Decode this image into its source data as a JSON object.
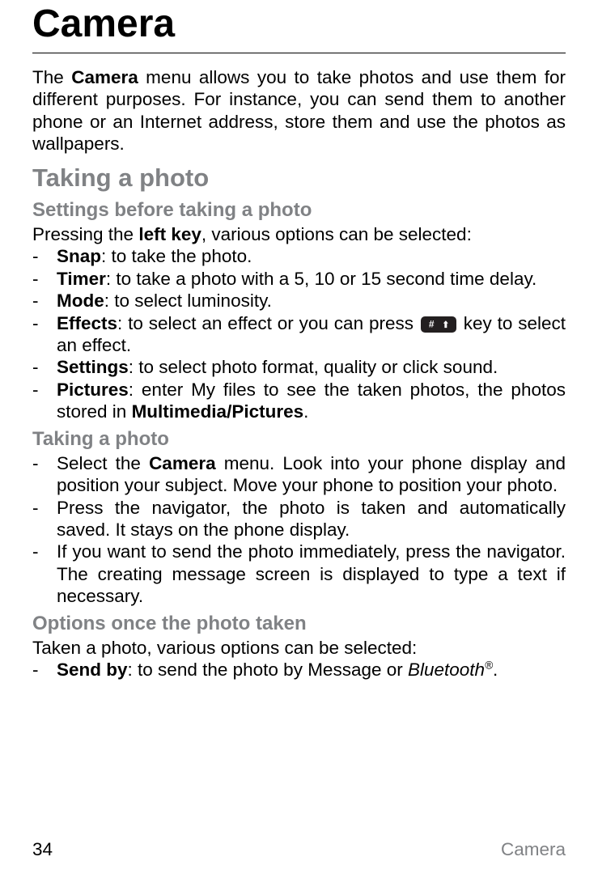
{
  "page_title": "Camera",
  "intro_parts": {
    "a": "The ",
    "b": "Camera",
    "c": " menu allows you to take photos and use them for different purposes. For instance, you can send them to another phone or an Internet address, store them and use the photos as wallpapers."
  },
  "h2_taking": "Taking a photo",
  "h3_settings": "Settings before taking a photo",
  "settings_intro_a": "Pressing the ",
  "settings_intro_b": "left key",
  "settings_intro_c": ", various options can be selected:",
  "opts": {
    "snap_label": "Snap",
    "snap_text": ": to take the photo.",
    "timer_label": "Timer",
    "timer_text": ": to take a photo with a 5, 10 or 15 second time delay.",
    "mode_label": "Mode",
    "mode_text": ": to select luminosity.",
    "effects_label": "Effects",
    "effects_text_a": ": to select an effect or you can press ",
    "effects_text_b": " key to select an effect.",
    "settings_label": "Settings",
    "settings_text": ": to select photo format, quality or click sound.",
    "pictures_label": "Pictures",
    "pictures_text_a": ": enter My files to see the taken photos, the photos stored in ",
    "pictures_text_b": "Multimedia/Pictures",
    "pictures_text_c": "."
  },
  "h3_taking": "Taking a photo",
  "steps": {
    "s1a": "Select the ",
    "s1b": "Camera",
    "s1c": " menu. Look into your phone display and position your subject. Move your phone to position your photo.",
    "s2": "Press the navigator, the photo is taken and automatically saved. It stays on the phone display.",
    "s3": "If you want to send the photo immediately, press the navigator. The creating message screen is displayed to type a text if necessary."
  },
  "h3_options": "Options once the photo taken",
  "options_intro": "Taken a photo, various options can be selected:",
  "sendby_label": "Send by",
  "sendby_text_a": ": to send the photo by Message or ",
  "sendby_text_b": "Bluetooth",
  "sendby_text_c": ".",
  "footer_page": "34",
  "footer_section": "Camera",
  "dash": "-"
}
